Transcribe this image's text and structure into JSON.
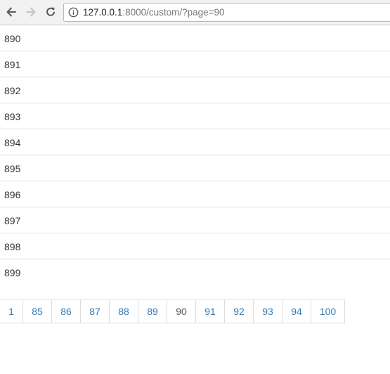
{
  "browser": {
    "url_host": "127.0.0.1",
    "url_rest": ":8000/custom/?page=90"
  },
  "rows": [
    "890",
    "891",
    "892",
    "893",
    "894",
    "895",
    "896",
    "897",
    "898",
    "899"
  ],
  "pagination": {
    "pages": [
      "1",
      "85",
      "86",
      "87",
      "88",
      "89",
      "90",
      "91",
      "92",
      "93",
      "94",
      "100"
    ],
    "current": "90"
  },
  "colors": {
    "link": "#337ab7",
    "border": "#dddddd",
    "text": "#333333"
  }
}
